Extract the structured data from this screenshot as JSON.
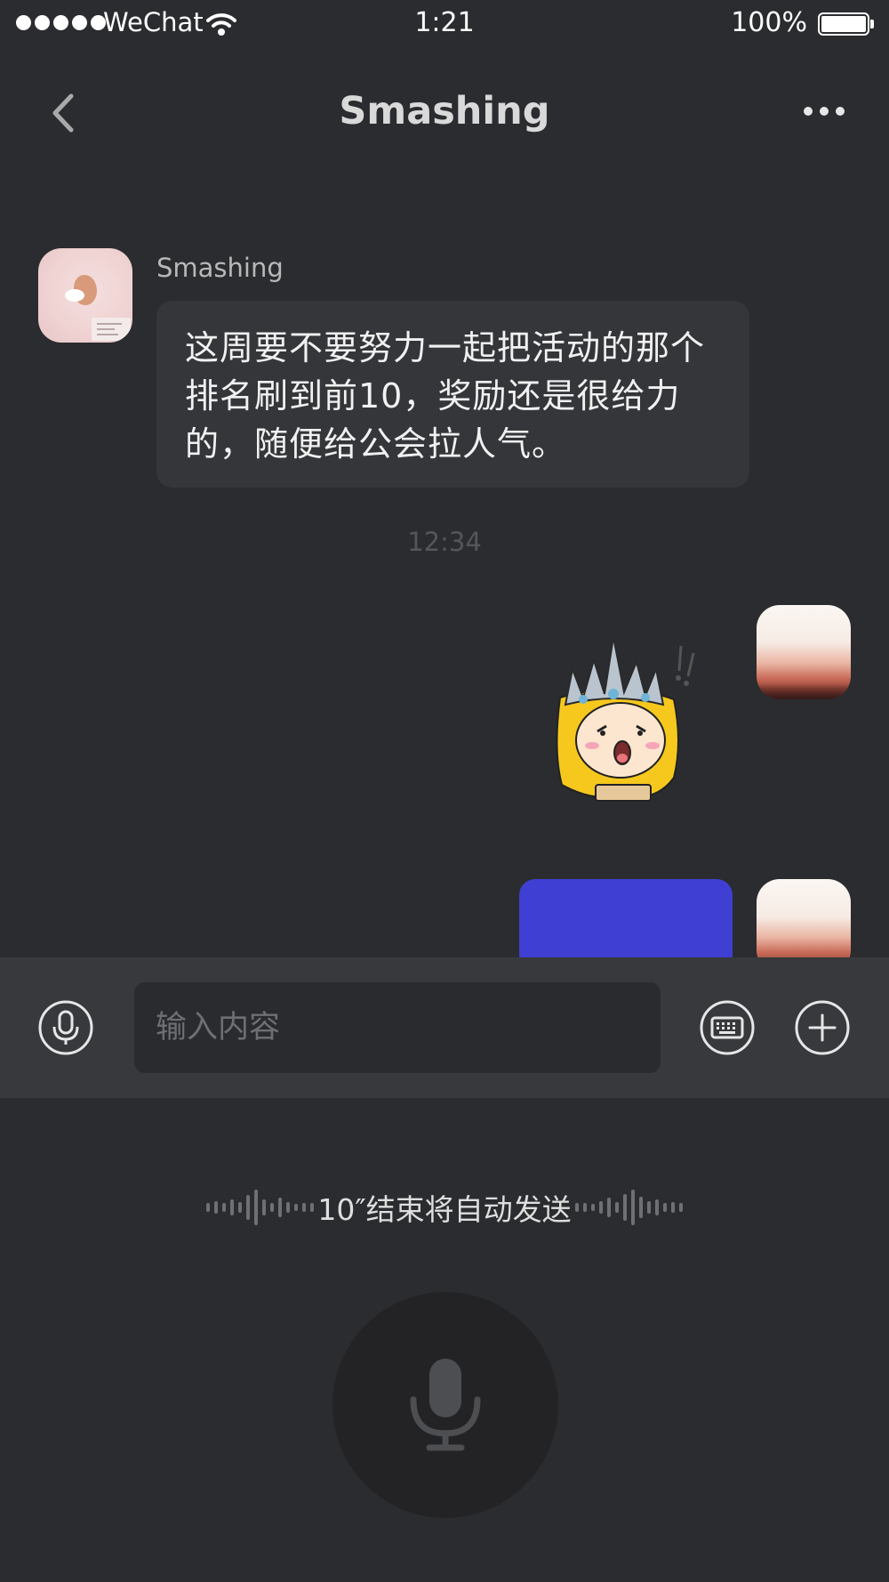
{
  "status_bar": {
    "carrier": "WeChat",
    "time": "1:21",
    "battery": "100%",
    "battery_level": 1.0
  },
  "nav": {
    "title": "Smashing",
    "back_icon": "chevron-left-icon",
    "more_icon": "more-dots-icon"
  },
  "messages": [
    {
      "sender": "Smashing",
      "text": "这周要不要努力一起把活动的那个\n排名刷到前10，奖励还是很给力\n的，随便给公会拉人气。"
    }
  ],
  "timestamp": "12:34",
  "input_bar": {
    "placeholder": "输入内容",
    "voice_icon": "microphone-icon",
    "keyboard_icon": "keyboard-icon",
    "add_icon": "plus-icon"
  },
  "voice_panel": {
    "hint": "10″结束将自动发送",
    "record_icon": "microphone-icon"
  },
  "colors": {
    "background": "#2b2c2f",
    "bubble_other": "#35363a",
    "bubble_self": "#3f3fd3",
    "input_bar": "#38393c"
  }
}
